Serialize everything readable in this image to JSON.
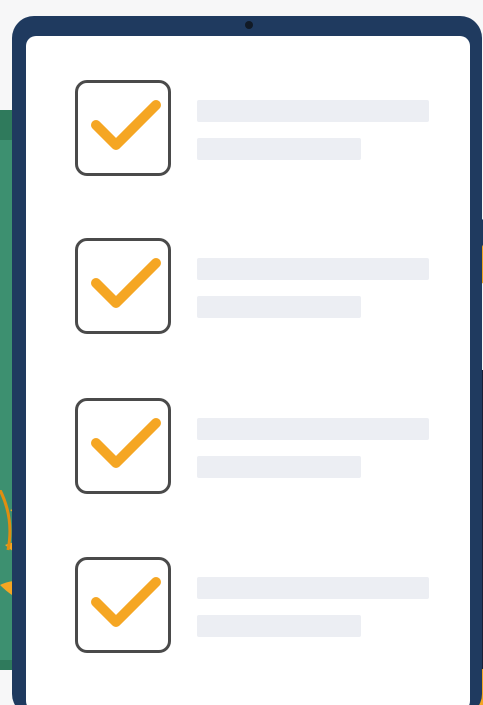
{
  "illustration": {
    "checklist_items": [
      {
        "checked": true
      },
      {
        "checked": true
      },
      {
        "checked": true
      },
      {
        "checked": true
      }
    ],
    "colors": {
      "tablet_frame": "#1f3a5f",
      "check_mark": "#f5a623",
      "placeholder_line": "#eceef3",
      "background_blob": "#2f7a5c",
      "leaves": "#f5a623"
    },
    "icons": {
      "check": "check-icon",
      "leaf": "leaf-icon"
    }
  }
}
